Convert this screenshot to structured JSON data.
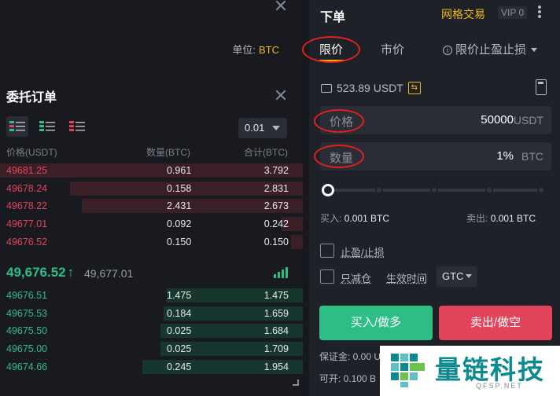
{
  "orderbook": {
    "unit_label": "单位:",
    "unit_value": "BTC",
    "title": "委托订单",
    "step": "0.01",
    "headers": {
      "price": "价格(USDT)",
      "amount": "数量(BTC)",
      "total": "合计(BTC)"
    },
    "asks": [
      {
        "price": "49681.25",
        "amount": "0.961",
        "total": "3.792",
        "depth": 1.0
      },
      {
        "price": "49678.24",
        "amount": "0.158",
        "total": "2.831",
        "depth": 0.77
      },
      {
        "price": "49678.22",
        "amount": "2.431",
        "total": "2.673",
        "depth": 0.73
      },
      {
        "price": "49677.01",
        "amount": "0.092",
        "total": "0.242",
        "depth": 0.07
      },
      {
        "price": "49676.52",
        "amount": "0.150",
        "total": "0.150",
        "depth": 0.04
      }
    ],
    "last_price": "49,676.52",
    "last_arrow": "↑",
    "mark_price": "49,677.01",
    "bids": [
      {
        "price": "49676.51",
        "amount": "1.475",
        "total": "1.475",
        "depth": 0.45
      },
      {
        "price": "49675.53",
        "amount": "0.184",
        "total": "1.659",
        "depth": 0.46
      },
      {
        "price": "49675.50",
        "amount": "0.025",
        "total": "1.684",
        "depth": 0.47
      },
      {
        "price": "49675.00",
        "amount": "0.025",
        "total": "1.709",
        "depth": 0.47
      },
      {
        "price": "49674.66",
        "amount": "0.245",
        "total": "1.954",
        "depth": 0.53
      }
    ]
  },
  "order_form": {
    "title": "下单",
    "grid_trading": "网格交易",
    "vip": "VIP 0",
    "tabs": {
      "limit": "限价",
      "market": "市价",
      "stop": "限价止盈止损"
    },
    "balance": "523.89 USDT",
    "price_label": "价格",
    "price_value": "50000",
    "price_unit": "USDT",
    "qty_label": "数量",
    "qty_value": "1%",
    "qty_unit": "BTC",
    "slider_percent": 0,
    "buy_label": "买入:",
    "buy_value": "0.001 BTC",
    "sell_label": "卖出:",
    "sell_value": "0.001 BTC",
    "tpsl": "止盈/止损",
    "reduce_only": "只减仓",
    "tif_label": "生效时间",
    "tif_value": "GTC",
    "buy_button": "买入/做多",
    "sell_button": "卖出/做空",
    "margin": "保证金: 0.00 U",
    "available": "可开: 0.100 B"
  },
  "watermark": {
    "text": "量链科技",
    "url": "QFSP.NET"
  },
  "colors": {
    "ask": "#e2455b",
    "bid": "#2ebd85",
    "accent": "#f0b90b",
    "annotation": "#e0221d"
  }
}
